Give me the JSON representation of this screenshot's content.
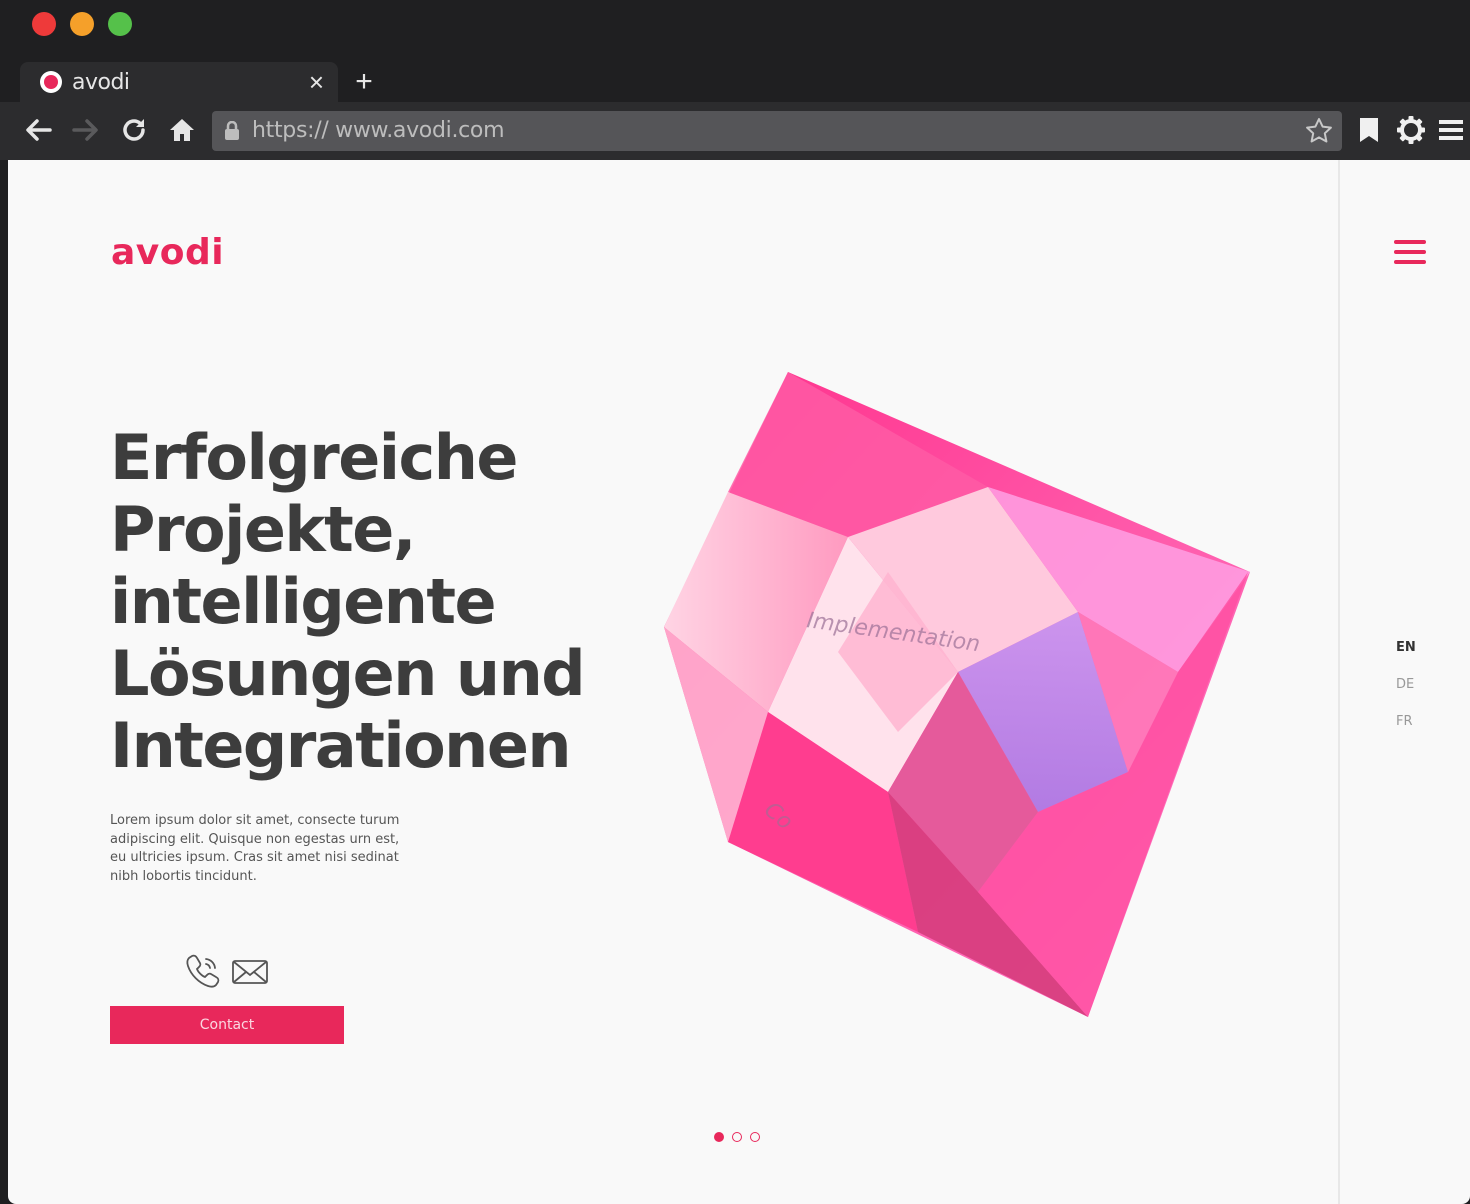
{
  "browser": {
    "tab": {
      "title": "avodi",
      "close_glyph": "×",
      "new_tab_glyph": "+"
    },
    "url": "https:// www.avodi.com",
    "traffic_lights": [
      "#ee3a3a",
      "#f5a02a",
      "#55c14a"
    ],
    "icons": [
      "back-arrow-icon",
      "forward-arrow-icon",
      "reload-icon",
      "home-icon",
      "lock-icon",
      "star-icon",
      "bookmark-icon",
      "settings-gear-icon",
      "menu-lines-icon"
    ]
  },
  "page": {
    "logo": "avodi",
    "headline": [
      "Erfolgreiche",
      "Projekte,",
      "intelligente",
      "Lösungen und",
      "Integrationen"
    ],
    "lead": "Lorem ipsum dolor sit amet, consecte turum adipiscing elit. Quisque non egestas urn est, eu ultricies ipsum. Cras sit amet nisi sedinat nibh lobortis tincidunt.",
    "contact_button": "Contact",
    "crystal_labels": [
      "Implementation",
      "Co"
    ],
    "languages": [
      {
        "code": "EN",
        "active": true
      },
      {
        "code": "DE",
        "active": false
      },
      {
        "code": "FR",
        "active": false
      }
    ],
    "slider": {
      "count": 3,
      "active_index": 0
    },
    "colors": {
      "brand": "#e8285b",
      "headline": "#3d3d3d",
      "chrome": "#1f1f21"
    }
  }
}
